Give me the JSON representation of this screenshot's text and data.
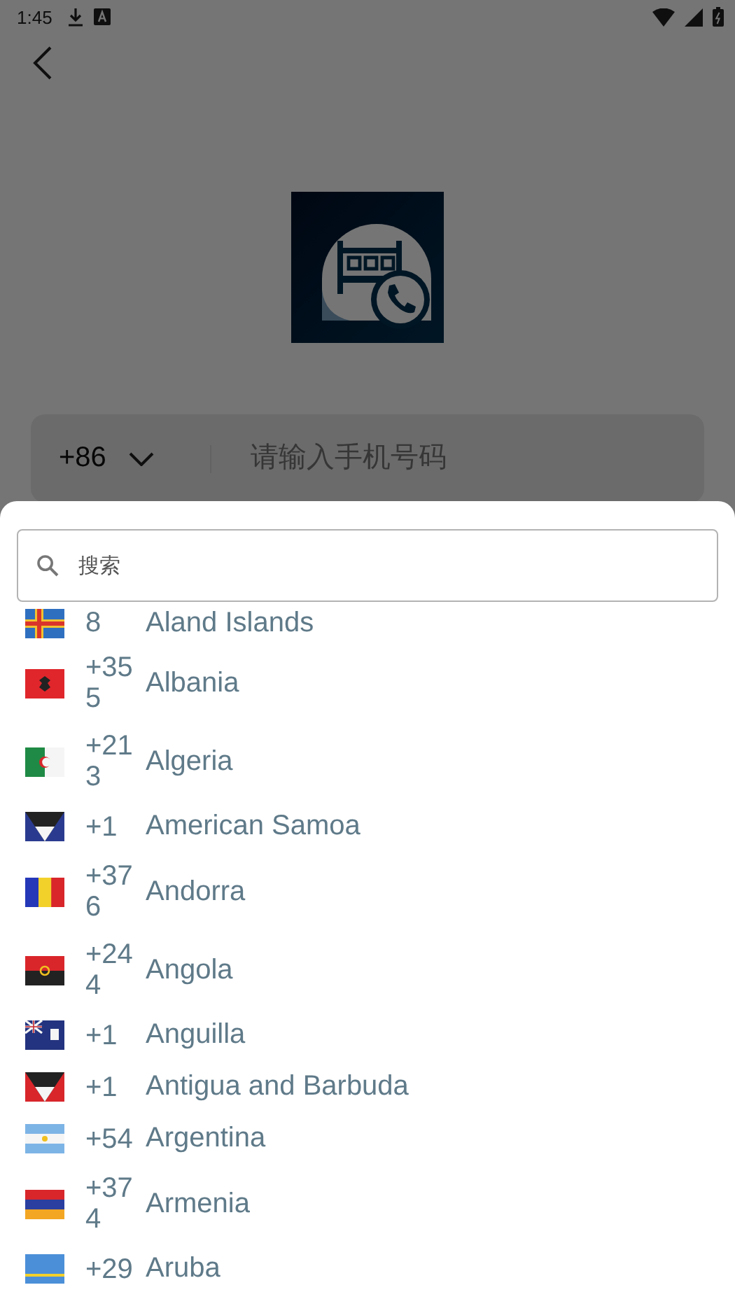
{
  "status_bar": {
    "time": "1:45"
  },
  "login": {
    "country_code": "+86",
    "phone_placeholder": "请输入手机号码"
  },
  "sheet": {
    "search": {
      "placeholder": "搜索"
    },
    "countries": [
      {
        "code": "8",
        "name": "Aland Islands",
        "kind": "cross",
        "color": "#2f6fc0"
      },
      {
        "code": "+355",
        "name": "Albania",
        "kind": "emblem",
        "color": "#e0262b"
      },
      {
        "code": "+213",
        "name": "Algeria",
        "kind": "hoist",
        "color": "#1f8a45"
      },
      {
        "code": "+1",
        "name": "American Samoa",
        "kind": "chevron",
        "color": "#2a3b8f"
      },
      {
        "code": "+376",
        "name": "Andorra",
        "kind": "vtri",
        "color": "#f3d12b"
      },
      {
        "code": "+244",
        "name": "Angola",
        "kind": "htwo",
        "color": "#d9262b"
      },
      {
        "code": "+1",
        "name": "Anguilla",
        "kind": "ensign",
        "color": "#23337f"
      },
      {
        "code": "+1",
        "name": "Antigua and Barbuda",
        "kind": "chevron",
        "color": "#d8262b"
      },
      {
        "code": "+54",
        "name": "Argentina",
        "kind": "hband",
        "color": "#7db4e6"
      },
      {
        "code": "+374",
        "name": "Armenia",
        "kind": "htri",
        "color": "#2a3fa0"
      },
      {
        "code": "+29",
        "name": "Aruba",
        "kind": "plain",
        "color": "#4b8fd8"
      }
    ]
  }
}
